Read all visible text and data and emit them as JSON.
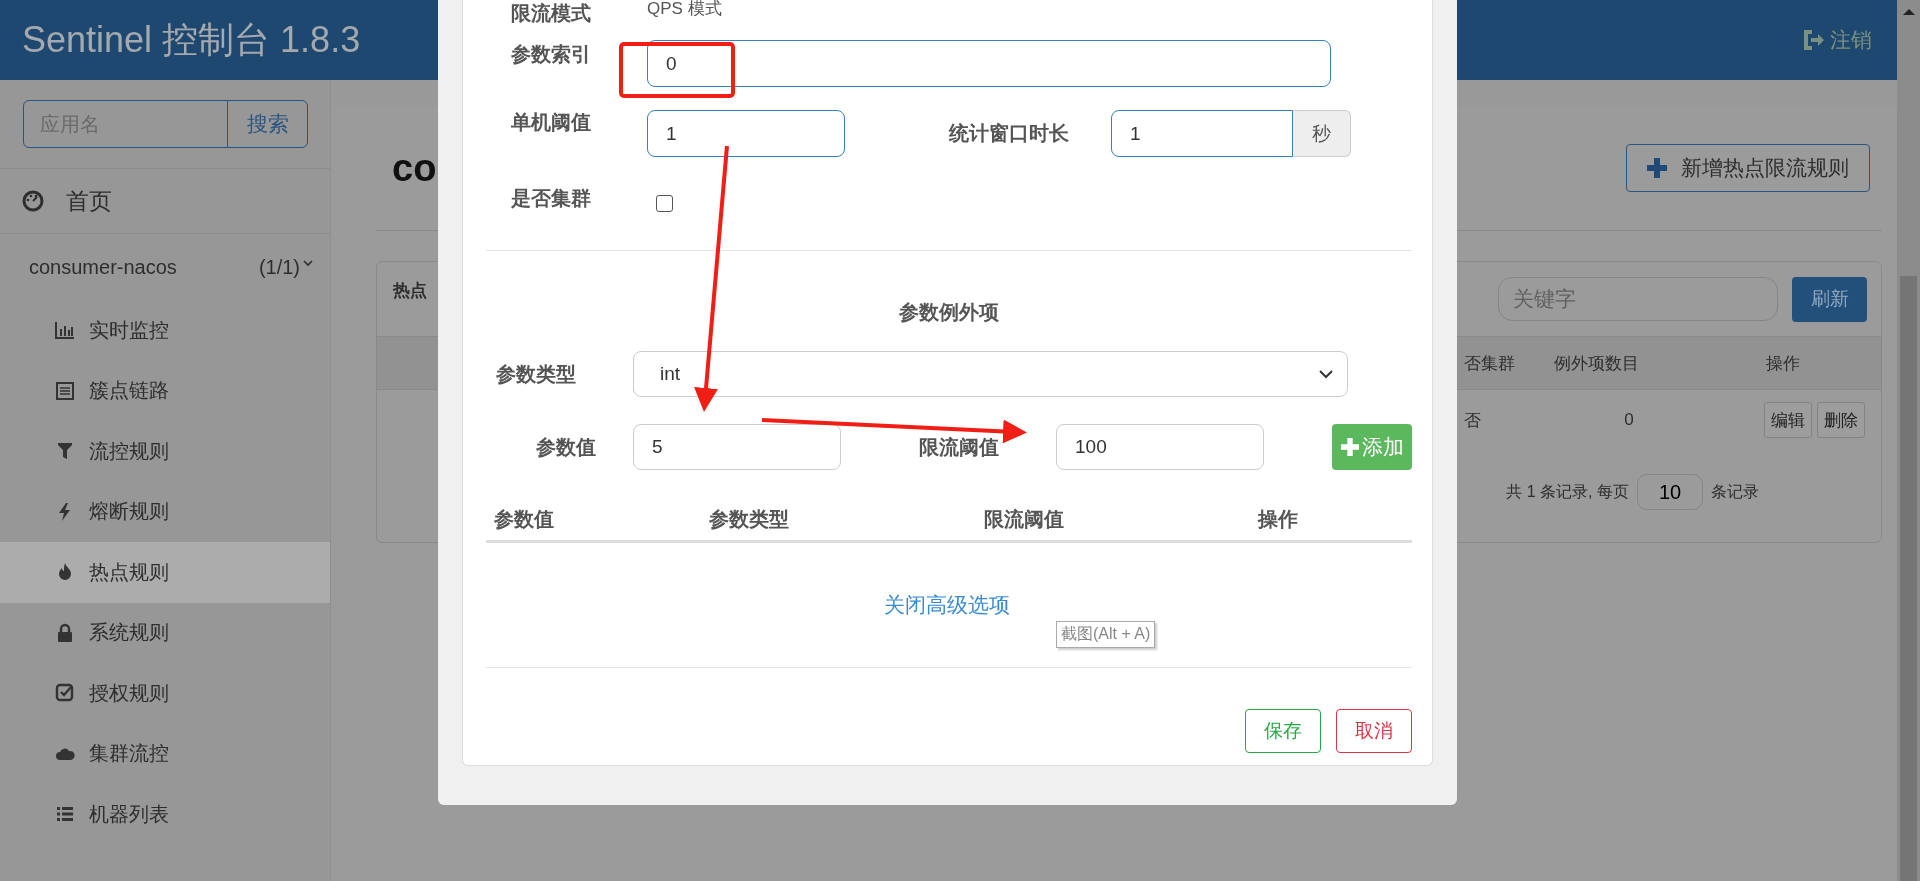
{
  "header": {
    "title": "Sentinel 控制台 1.8.3",
    "logout": "注销"
  },
  "sidebar": {
    "search": {
      "placeholder": "应用名",
      "button": "搜索"
    },
    "home": "首页",
    "app": {
      "name": "consumer-nacos",
      "count": "(1/1)",
      "expanded": true
    },
    "items": [
      {
        "label": "实时监控",
        "selected": false
      },
      {
        "label": "簇点链路",
        "selected": false
      },
      {
        "label": "流控规则",
        "selected": false
      },
      {
        "label": "熔断规则",
        "selected": false
      },
      {
        "label": "热点规则",
        "selected": true
      },
      {
        "label": "系统规则",
        "selected": false
      },
      {
        "label": "授权规则",
        "selected": false
      },
      {
        "label": "集群流控",
        "selected": false
      },
      {
        "label": "机器列表",
        "selected": false
      }
    ]
  },
  "main": {
    "title": "co",
    "add_button": "新增热点限流规则",
    "card": {
      "title": "热点",
      "search_placeholder": "关键字",
      "refresh": "刷新",
      "columns": [
        "否集群",
        "例外项数目",
        "操作"
      ],
      "rows": [
        {
          "cells": [
            "否",
            "0"
          ],
          "actions": [
            "编辑",
            "删除"
          ]
        }
      ],
      "pagination": {
        "prefix": "共 1 条记录, 每页",
        "page_size": "10",
        "suffix": "条记录"
      }
    }
  },
  "modal": {
    "mode": {
      "label": "限流模式",
      "value": "QPS 模式"
    },
    "param_index": {
      "label": "参数索引",
      "value": "0"
    },
    "threshold": {
      "label": "单机阈值",
      "value": "1"
    },
    "window": {
      "label": "统计窗口时长",
      "value": "1",
      "unit": "秒"
    },
    "cluster": {
      "label": "是否集群",
      "checked": false
    },
    "exceptions": {
      "title": "参数例外项",
      "type": {
        "label": "参数类型",
        "value": "int"
      },
      "value": {
        "label": "参数值",
        "value": "5"
      },
      "limit": {
        "label": "限流阈值",
        "value": "100"
      },
      "add": "添加",
      "columns": [
        "参数值",
        "参数类型",
        "限流阈值",
        "操作"
      ]
    },
    "toggle_link": "关闭高级选项",
    "save": "保存",
    "cancel": "取消"
  },
  "tooltip": "截图(Alt + A)"
}
